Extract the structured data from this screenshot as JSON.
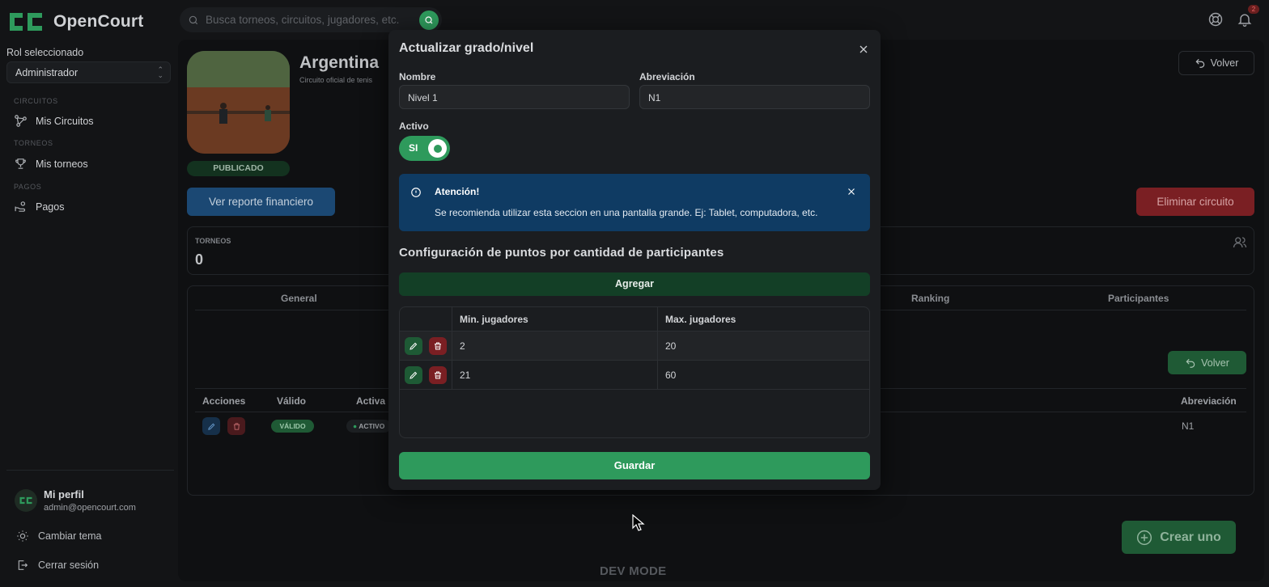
{
  "app": {
    "name": "OpenCourt"
  },
  "sidebar": {
    "role_label": "Rol seleccionado",
    "role_value": "Administrador",
    "sections": [
      {
        "title": "CIRCUITOS",
        "item": "Mis Circuitos"
      },
      {
        "title": "TORNEOS",
        "item": "Mis torneos"
      },
      {
        "title": "PAGOS",
        "item": "Pagos"
      }
    ],
    "profile": {
      "name": "Mi perfil",
      "email": "admin@opencourt.com"
    },
    "footer": {
      "theme": "Cambiar tema",
      "logout": "Cerrar sesión"
    }
  },
  "topbar": {
    "search_placeholder": "Busca torneos, circuitos, jugadores, etc.",
    "notification_count": "2"
  },
  "page": {
    "title": "Argentina",
    "subtitle": "Circuito oficial de tenis",
    "status": "PUBLICADO",
    "report_button": "Ver reporte financiero",
    "back_button": "Volver",
    "delete_button": "Eliminar circuito",
    "stat": {
      "label": "TORNEOS",
      "value": "0"
    },
    "tabs": [
      "General",
      "Ranking",
      "Participantes"
    ],
    "back_button_2": "Volver",
    "table": {
      "headers": {
        "actions": "Acciones",
        "valid": "Válido",
        "active": "Activa",
        "abbr": "Abreviación"
      },
      "row": {
        "valid": "VÁLIDO",
        "active": "ACTIVO",
        "abbr": "N1"
      }
    },
    "create_button": "Crear uno",
    "dev_mode": "DEV MODE"
  },
  "modal": {
    "title": "Actualizar grado/nivel",
    "name_label": "Nombre",
    "name_value": "Nivel 1",
    "abbr_label": "Abreviación",
    "abbr_value": "N1",
    "active_label": "Activo",
    "toggle_text": "SI",
    "toggle_on": true,
    "alert": {
      "title": "Atención!",
      "message": "Se recomienda utilizar esta seccion en una pantalla grande. Ej: Tablet, computadora, etc."
    },
    "points_heading": "Configuración de puntos por cantidad de participantes",
    "add_button": "Agregar",
    "table": {
      "headers": [
        "Min. jugadores",
        "Max. jugadores"
      ],
      "rows": [
        {
          "min": "2",
          "max": "20"
        },
        {
          "min": "21",
          "max": "60"
        }
      ]
    },
    "save_button": "Guardar"
  },
  "colors": {
    "accent": "#2e9a5c",
    "danger": "#7a1f23",
    "info": "#0f3b63"
  }
}
